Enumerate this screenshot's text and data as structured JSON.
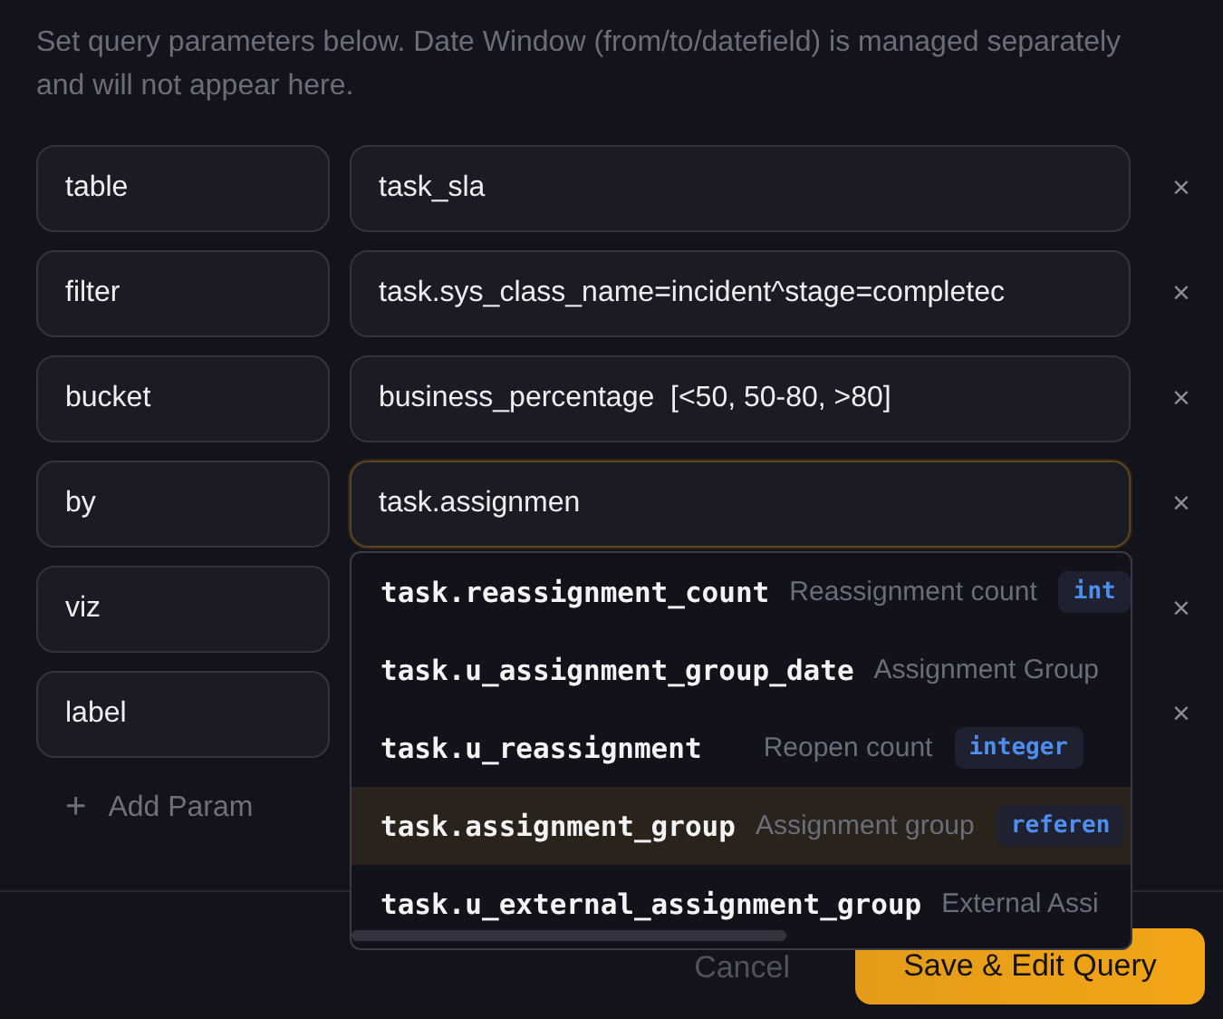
{
  "description": "Set query parameters below. Date Window (from/to/datefield) is managed separately and will not appear here.",
  "params": [
    {
      "key": "table",
      "value": "task_sla",
      "focused": false
    },
    {
      "key": "filter",
      "value": "task.sys_class_name=incident^stage=completec",
      "focused": false
    },
    {
      "key": "bucket",
      "value": "business_percentage  [<50, 50-80, >80]",
      "focused": false
    },
    {
      "key": "by",
      "value": "task.assignmen",
      "focused": true
    },
    {
      "key": "viz"
    },
    {
      "key": "label"
    }
  ],
  "remove_icon": "×",
  "add_param": {
    "icon": "+",
    "label": "Add Param"
  },
  "suggestions": [
    {
      "field": "task.reassignment_count",
      "label": "Reassignment count",
      "type": "int",
      "highlighted": false
    },
    {
      "field": "task.u_assignment_group_date",
      "label": "Assignment Group",
      "highlighted": false
    },
    {
      "field": "task.u_reassignment",
      "label": "Reopen count",
      "type": "integer",
      "highlighted": false
    },
    {
      "field": "task.assignment_group",
      "label": "Assignment group",
      "type": "referen",
      "highlighted": true
    },
    {
      "field": "task.u_external_assignment_group",
      "label": "External Assi",
      "highlighted": false
    }
  ],
  "buttons": {
    "cancel": "Cancel",
    "save": "Save & Edit Query"
  }
}
